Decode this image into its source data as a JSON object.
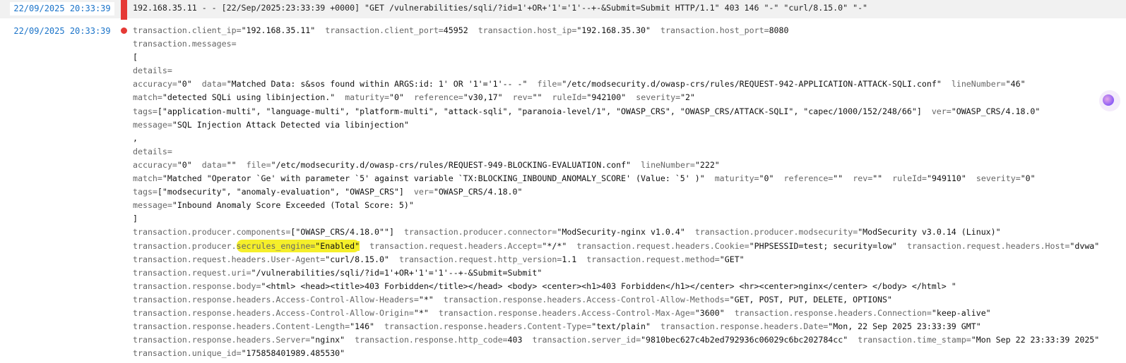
{
  "row1": {
    "timestamp": "22/09/2025 20:33:39",
    "raw": "192.168.35.11 - - [22/Sep/2025:23:33:39 +0000] \"GET /vulnerabilities/sqli/?id=1'+OR+'1'='1'--+-&Submit=Submit HTTP/1.1\" 403 146 \"-\" \"curl/8.15.0\" \"-\""
  },
  "row2": {
    "timestamp": "22/09/2025 20:33:39",
    "lines": [
      [
        [
          "transaction.client_ip=",
          "\"192.168.35.11\""
        ],
        [
          "transaction.client_port=",
          "45952"
        ],
        [
          "transaction.host_ip=",
          "\"192.168.35.30\""
        ],
        [
          "transaction.host_port=",
          "8080"
        ]
      ],
      [
        [
          "transaction.messages=",
          ""
        ]
      ],
      [
        [
          "",
          "["
        ]
      ],
      [
        [
          "details=",
          ""
        ]
      ],
      [
        [
          "accuracy=",
          "\"0\""
        ],
        [
          "data=",
          "\"Matched Data: s&sos found within ARGS:id: 1' OR '1'='1'-- -\""
        ],
        [
          "file=",
          "\"/etc/modsecurity.d/owasp-crs/rules/REQUEST-942-APPLICATION-ATTACK-SQLI.conf\""
        ],
        [
          "lineNumber=",
          "\"46\""
        ]
      ],
      [
        [
          "match=",
          "\"detected SQLi using libinjection.\""
        ],
        [
          "maturity=",
          "\"0\""
        ],
        [
          "reference=",
          "\"v30,17\""
        ],
        [
          "rev=",
          "\"\""
        ],
        [
          "ruleId=",
          "\"942100\""
        ],
        [
          "severity=",
          "\"2\""
        ]
      ],
      [
        [
          "tags=",
          "[\"application-multi\", \"language-multi\", \"platform-multi\", \"attack-sqli\", \"paranoia-level/1\", \"OWASP_CRS\", \"OWASP_CRS/ATTACK-SQLI\", \"capec/1000/152/248/66\"]"
        ],
        [
          "ver=",
          "\"OWASP_CRS/4.18.0\""
        ]
      ],
      [
        [
          "message=",
          "\"SQL Injection Attack Detected via libinjection\""
        ]
      ],
      [
        [
          "",
          ","
        ]
      ],
      [
        [
          "details=",
          ""
        ]
      ],
      [
        [
          "accuracy=",
          "\"0\""
        ],
        [
          "data=",
          "\"\""
        ],
        [
          "file=",
          "\"/etc/modsecurity.d/owasp-crs/rules/REQUEST-949-BLOCKING-EVALUATION.conf\""
        ],
        [
          "lineNumber=",
          "\"222\""
        ]
      ],
      [
        [
          "match=",
          "\"Matched \"Operator `Ge' with parameter `5' against variable `TX:BLOCKING_INBOUND_ANOMALY_SCORE' (Value: `5' )\""
        ],
        [
          "maturity=",
          "\"0\""
        ],
        [
          "reference=",
          "\"\""
        ],
        [
          "rev=",
          "\"\""
        ],
        [
          "ruleId=",
          "\"949110\""
        ],
        [
          "severity=",
          "\"0\""
        ]
      ],
      [
        [
          "tags=",
          "[\"modsecurity\", \"anomaly-evaluation\", \"OWASP_CRS\"]"
        ],
        [
          "ver=",
          "\"OWASP_CRS/4.18.0\""
        ]
      ],
      [
        [
          "message=",
          "\"Inbound Anomaly Score Exceeded (Total Score: 5)\""
        ]
      ],
      [
        [
          "",
          "]"
        ]
      ],
      [
        [
          "transaction.producer.components=",
          "[\"OWASP_CRS/4.18.0\"\"]"
        ],
        [
          "transaction.producer.connector=",
          "\"ModSecurity-nginx v1.0.4\""
        ],
        [
          "transaction.producer.modsecurity=",
          "\"ModSecurity v3.0.14 (Linux)\""
        ]
      ],
      [
        [
          "transaction.producer.secrules_engine=",
          "\"Enabled\""
        ],
        [
          "transaction.request.headers.Accept=",
          "\"*/*\""
        ],
        [
          "transaction.request.headers.Cookie=",
          "\"PHPSESSID=test; security=low\""
        ],
        [
          "transaction.request.headers.Host=",
          "\"dvwa\""
        ]
      ],
      [
        [
          "transaction.request.headers.User-Agent=",
          "\"curl/8.15.0\""
        ],
        [
          "transaction.request.http_version=",
          "1.1"
        ],
        [
          "transaction.request.method=",
          "\"GET\""
        ]
      ],
      [
        [
          "transaction.request.uri=",
          "\"/vulnerabilities/sqli/?id=1'+OR+'1'='1'--+-&Submit=Submit\""
        ]
      ],
      [
        [
          "transaction.response.body=",
          "\"<html> <head><title>403 Forbidden</title></head> <body> <center><h1>403 Forbidden</h1></center> <hr><center>nginx</center> </body> </html> \""
        ]
      ],
      [
        [
          "transaction.response.headers.Access-Control-Allow-Headers=",
          "\"*\""
        ],
        [
          "transaction.response.headers.Access-Control-Allow-Methods=",
          "\"GET, POST, PUT, DELETE, OPTIONS\""
        ]
      ],
      [
        [
          "transaction.response.headers.Access-Control-Allow-Origin=",
          "\"*\""
        ],
        [
          "transaction.response.headers.Access-Control-Max-Age=",
          "\"3600\""
        ],
        [
          "transaction.response.headers.Connection=",
          "\"keep-alive\""
        ]
      ],
      [
        [
          "transaction.response.headers.Content-Length=",
          "\"146\""
        ],
        [
          "transaction.response.headers.Content-Type=",
          "\"text/plain\""
        ],
        [
          "transaction.response.headers.Date=",
          "\"Mon, 22 Sep 2025 23:33:39 GMT\""
        ]
      ],
      [
        [
          "transaction.response.headers.Server=",
          "\"nginx\""
        ],
        [
          "transaction.response.http_code=",
          "403"
        ],
        [
          "transaction.server_id=",
          "\"9810bec627c4b2ed792936c06029c6bc202784cc\""
        ],
        [
          "transaction.time_stamp=",
          "\"Mon Sep 22 23:33:39 2025\""
        ]
      ],
      [
        [
          "transaction.unique_id=",
          "\"175858401989.485530\""
        ]
      ]
    ]
  },
  "highlight": {
    "line": 16,
    "key_fragment": "secrules_engine=",
    "prefix": "transaction.producer.",
    "color": "#f5ef2a"
  },
  "colors": {
    "timestamp": "#1a73c9",
    "alert": "#e53935",
    "key": "#666666",
    "value": "#111111"
  },
  "icons": {
    "edge": "copilot-icon"
  }
}
